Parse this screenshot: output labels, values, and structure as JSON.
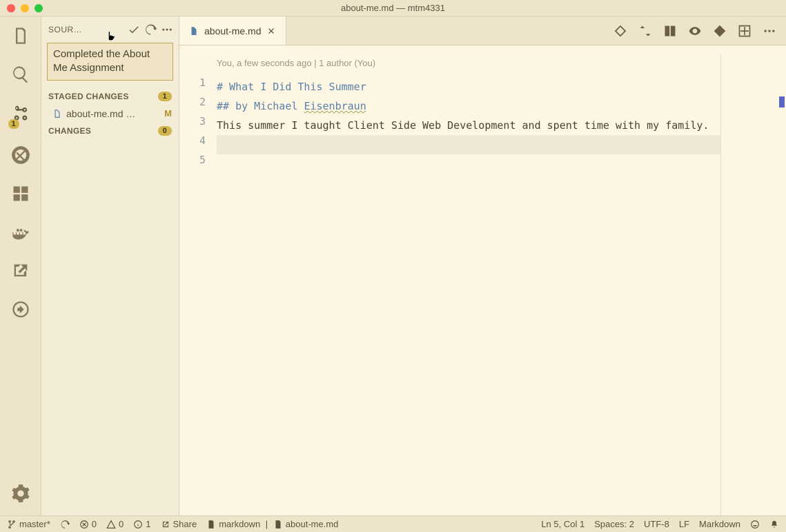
{
  "window": {
    "title": "about-me.md — mtm4331"
  },
  "activityBar": {
    "scmBadge": "1"
  },
  "sidebar": {
    "title": "SOUR…",
    "commitMessage": "Completed the About Me Assignment",
    "sections": {
      "staged": {
        "label": "STAGED CHANGES",
        "count": "1"
      },
      "changes": {
        "label": "CHANGES",
        "count": "0"
      }
    },
    "stagedFile": {
      "name": "about-me.md …",
      "status": "M"
    }
  },
  "editor": {
    "tab": {
      "label": "about-me.md"
    },
    "codelens": "You, a few seconds ago | 1 author (You)",
    "lines": {
      "l1": "# What I Did This Summer",
      "l2a": "## by Michael ",
      "l2b": "Eisenbraun",
      "l3": "",
      "l4": "This summer I taught Client Side Web Development and spent time with my family.",
      "l5": ""
    }
  },
  "status": {
    "branch": "master*",
    "errors": "0",
    "warnings": "0",
    "info": "1",
    "share": "Share",
    "lang1": "markdown",
    "lang2": "about-me.md",
    "pos": "Ln 5, Col 1",
    "spaces": "Spaces: 2",
    "encoding": "UTF-8",
    "eol": "LF",
    "mode": "Markdown"
  }
}
